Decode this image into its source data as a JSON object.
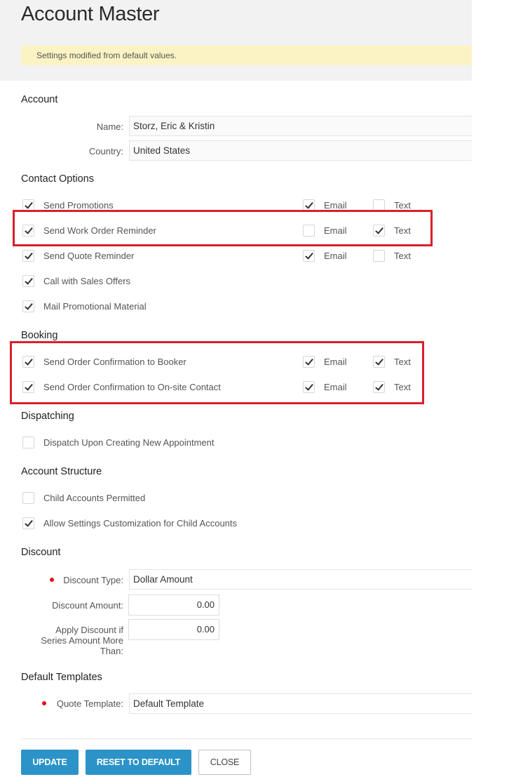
{
  "page": {
    "title": "Account Master",
    "notice": "Settings modified from default values."
  },
  "sections": {
    "account": "Account",
    "contact_options": "Contact Options",
    "booking": "Booking",
    "dispatching": "Dispatching",
    "account_structure": "Account Structure",
    "discount": "Discount",
    "default_templates": "Default Templates"
  },
  "account": {
    "name_label": "Name:",
    "name_value": "Storz, Eric & Kristin",
    "country_label": "Country:",
    "country_value": "United States"
  },
  "channel_labels": {
    "email": "Email",
    "text": "Text"
  },
  "contact_options": [
    {
      "label": "Send Promotions",
      "checked": true,
      "email": true,
      "text": false
    },
    {
      "label": "Send Work Order Reminder",
      "checked": true,
      "email": false,
      "text": true
    },
    {
      "label": "Send Quote Reminder",
      "checked": true,
      "email": true,
      "text": false
    },
    {
      "label": "Call with Sales Offers",
      "checked": true
    },
    {
      "label": "Mail Promotional Material",
      "checked": true
    }
  ],
  "booking": [
    {
      "label": "Send Order Confirmation to Booker",
      "checked": true,
      "email": true,
      "text": true
    },
    {
      "label": "Send Order Confirmation to On-site Contact",
      "checked": true,
      "email": true,
      "text": true
    }
  ],
  "dispatching": [
    {
      "label": "Dispatch Upon Creating New Appointment",
      "checked": false
    }
  ],
  "account_structure": [
    {
      "label": "Child Accounts Permitted",
      "checked": false
    },
    {
      "label": "Allow Settings Customization for Child Accounts",
      "checked": true
    }
  ],
  "discount": {
    "type_label": "Discount Type:",
    "type_value": "Dollar Amount",
    "amount_label": "Discount Amount:",
    "amount_value": "0.00",
    "apply_label_line1": "Apply Discount if",
    "apply_label_line2": "Series Amount More",
    "apply_label_line3": "Than:",
    "apply_value": "0.00"
  },
  "templates": {
    "quote_label": "Quote Template:",
    "quote_value": "Default Template"
  },
  "buttons": {
    "update": "UPDATE",
    "reset": "RESET TO DEFAULT",
    "close": "CLOSE"
  },
  "colors": {
    "highlight": "#d9202b",
    "primary_button": "#2b93c8",
    "notice_bg": "#fbf3c4",
    "required_dot": "#e0141e"
  }
}
